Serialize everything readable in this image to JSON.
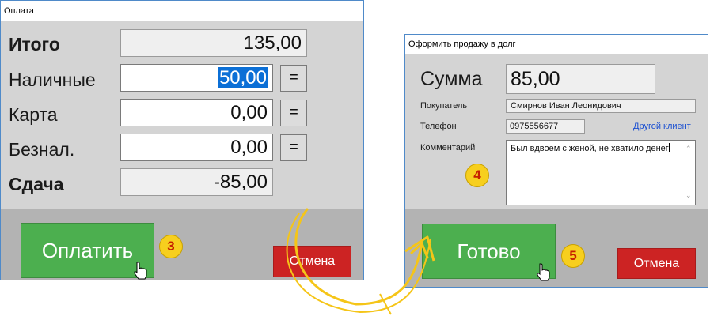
{
  "payment": {
    "title": "Оплата",
    "total_label": "Итого",
    "total_value": "135,00",
    "cash_label": "Наличные",
    "cash_value": "50,00",
    "card_label": "Карта",
    "card_value": "0,00",
    "bank_label": "Безнал.",
    "bank_value": "0,00",
    "change_label": "Сдача",
    "change_value": "-85,00",
    "eq_label": "=",
    "pay_button": "Оплатить",
    "cancel_button": "Отмена"
  },
  "debt": {
    "title": "Оформить продажу в долг",
    "sum_label": "Сумма",
    "sum_value": "85,00",
    "buyer_label": "Покупатель",
    "buyer_value": "Смирнов Иван Леонидович",
    "phone_label": "Телефон",
    "phone_value": "0975556677",
    "other_client_link": "Другой клиент",
    "comment_label": "Комментарий",
    "comment_value": "Был вдвоем с женой, не хватило денег",
    "done_button": "Готово",
    "cancel_button": "Отмена"
  },
  "badges": [
    "3",
    "4",
    "5"
  ],
  "colors": {
    "window_bg": "#d4d4d4",
    "bottom_bar": "#b3b3b3",
    "green_button": "#4caf4f",
    "red_button": "#cc2323",
    "badge_fill": "#f7cf1e",
    "badge_text": "#c62000",
    "arrow": "#f5c518",
    "link": "#1a4fd1",
    "selection": "#0b6fd6"
  }
}
